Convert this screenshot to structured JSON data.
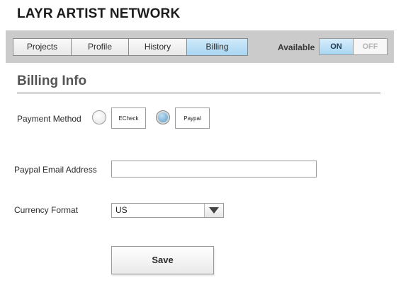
{
  "app": {
    "title": "LAYR ARTIST NETWORK"
  },
  "nav": {
    "tabs": [
      {
        "label": "Projects",
        "active": false
      },
      {
        "label": "Profile",
        "active": false
      },
      {
        "label": "History",
        "active": false
      },
      {
        "label": "Billing",
        "active": true
      }
    ]
  },
  "availability": {
    "label": "Available",
    "on_label": "ON",
    "off_label": "OFF",
    "state": "ON"
  },
  "billing": {
    "section_title": "Billing Info",
    "payment_method": {
      "label": "Payment Method",
      "options": [
        {
          "label": "ECheck",
          "selected": false
        },
        {
          "label": "Paypal",
          "selected": true
        }
      ]
    },
    "email": {
      "label": "Paypal Email Address",
      "value": "",
      "placeholder": ""
    },
    "currency": {
      "label": "Currency Format",
      "selected": "US"
    },
    "save_label": "Save"
  },
  "colors": {
    "accent": "#a9d6f2",
    "toolbar_bg": "#cbcbcb"
  }
}
